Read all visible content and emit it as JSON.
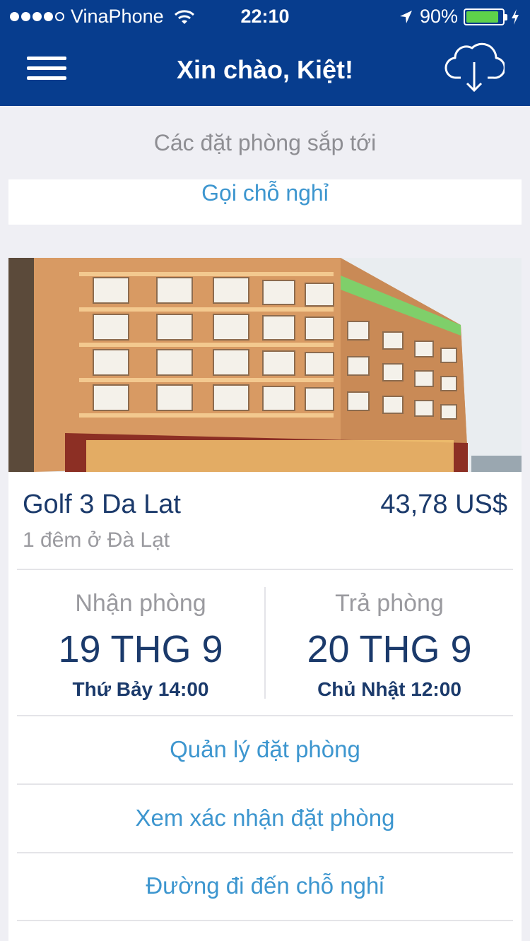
{
  "status_bar": {
    "carrier": "VinaPhone",
    "time": "22:10",
    "battery_percent": "90%",
    "battery_level": 0.9
  },
  "header": {
    "title": "Xin chào, Kiệt!"
  },
  "upcoming": {
    "section_title": "Các đặt phòng sắp tới",
    "call_property_label": "Gọi chỗ nghỉ"
  },
  "booking": {
    "hotel_name": "Golf 3 Da Lat",
    "price": "43,78 US$",
    "subtitle": "1 đêm ở Đà Lạt",
    "checkin": {
      "label": "Nhận phòng",
      "date": "19 THG 9",
      "time": "Thứ Bảy 14:00"
    },
    "checkout": {
      "label": "Trả phòng",
      "date": "20 THG 9",
      "time": "Chủ Nhật 12:00"
    },
    "actions": [
      {
        "label": "Quản lý đặt phòng"
      },
      {
        "label": "Xem xác nhận đặt phòng"
      },
      {
        "label": "Đường đi đến chỗ nghỉ"
      }
    ]
  },
  "colors": {
    "header_bg": "#073d8e",
    "link": "#3d96cf",
    "text_dark": "#1b3a6b",
    "text_muted": "#9a9a9f",
    "background": "#efeff4"
  }
}
